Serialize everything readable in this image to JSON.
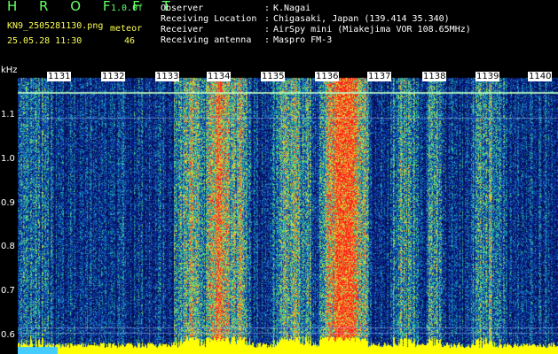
{
  "header": {
    "app_title": "H R O F F T",
    "version": "1.0.0f",
    "filename": "KN9_2505281130.png",
    "meteor_label": "meteor",
    "meteor_count": "46",
    "measure_time": "25.05.28 11:30",
    "info": [
      {
        "label": "Observer",
        "value": "K.Nagai"
      },
      {
        "label": "Receiving Location",
        "value": "Chigasaki, Japan (139.414 35.340)"
      },
      {
        "label": "Receiver",
        "value": "AirSpy mini (Miakejima VOR 108.65MHz)"
      },
      {
        "label": "Receiving antenna",
        "value": "Maspro FM-3"
      }
    ]
  },
  "colors": {
    "title_green": "#66ff66",
    "header_yellow": "#ffff55",
    "info_white": "#ffffff",
    "background": "#000000",
    "spectrum_low": "#0a1a80",
    "spectrum_mid": "#22cc88",
    "spectrum_high": "#ff2222",
    "meteor_yellow": "#ffff00"
  },
  "plot": {
    "y_unit": "kHz",
    "y_ticks": [
      "1.1",
      "1.0",
      "0.9",
      "0.8",
      "0.7",
      "0.6"
    ],
    "x_ticks": [
      "1131",
      "1132",
      "1133",
      "1134",
      "1135",
      "1136",
      "1137",
      "1138",
      "1139",
      "1140"
    ],
    "y_range_khz": [
      0.57,
      1.2
    ],
    "x_range_minutes": [
      "11:30",
      "11:40"
    ]
  }
}
